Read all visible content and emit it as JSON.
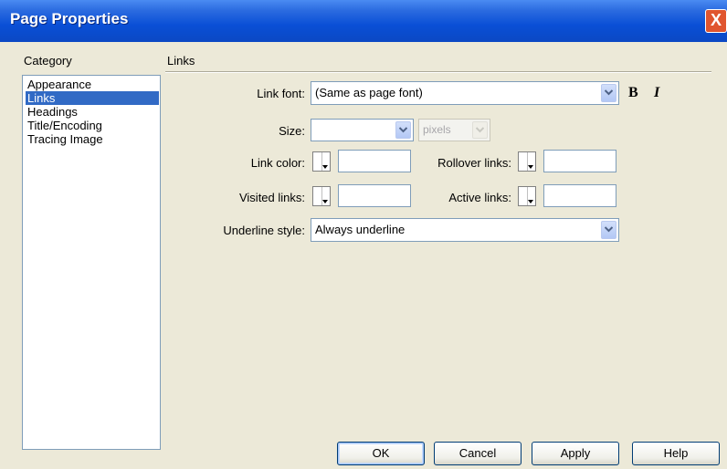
{
  "window": {
    "title": "Page Properties",
    "close_glyph": "X"
  },
  "category": {
    "header": "Category",
    "items": [
      {
        "label": "Appearance",
        "selected": false
      },
      {
        "label": "Links",
        "selected": true
      },
      {
        "label": "Headings",
        "selected": false
      },
      {
        "label": "Title/Encoding",
        "selected": false
      },
      {
        "label": "Tracing Image",
        "selected": false
      }
    ]
  },
  "section": {
    "title": "Links"
  },
  "form": {
    "link_font_label": "Link font:",
    "link_font_value": "(Same as page font)",
    "bold_glyph": "B",
    "italic_glyph": "I",
    "size_label": "Size:",
    "size_value": "",
    "size_unit": "pixels",
    "link_color_label": "Link color:",
    "link_color_value": "",
    "rollover_label": "Rollover links:",
    "rollover_value": "",
    "visited_label": "Visited links:",
    "visited_value": "",
    "active_label": "Active links:",
    "active_value": "",
    "underline_label": "Underline style:",
    "underline_value": "Always underline"
  },
  "buttons": {
    "ok": "OK",
    "cancel": "Cancel",
    "apply": "Apply",
    "help": "Help"
  },
  "colors": {
    "accent": "#316ac5",
    "titlebar": "#0a4fd6",
    "background": "#ece9d8",
    "close": "#e0552f"
  }
}
